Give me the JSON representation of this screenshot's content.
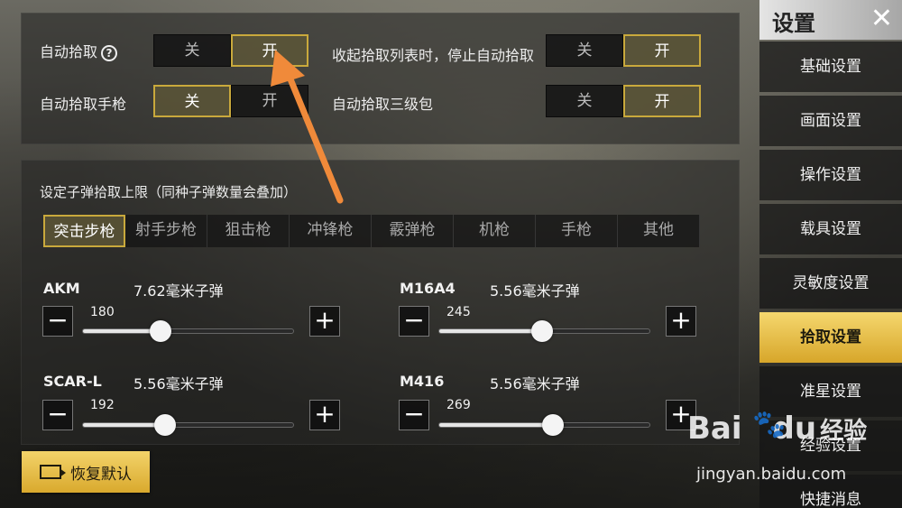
{
  "pickup": {
    "auto_pickup_label": "自动拾取",
    "help_icon": "?",
    "auto_pickup_off": "关",
    "auto_pickup_on": "开",
    "auto_pickup_state": "on",
    "pistol_label": "自动拾取手枪",
    "pistol_off": "关",
    "pistol_on": "开",
    "pistol_state": "off",
    "collapse_label": "收起拾取列表时，停止自动拾取",
    "collapse_off": "关",
    "collapse_on": "开",
    "collapse_state": "on",
    "backpack_label": "自动拾取三级包",
    "backpack_off": "关",
    "backpack_on": "开",
    "backpack_state": "on"
  },
  "ammo": {
    "section_title": "设定子弹拾取上限（同种子弹数量会叠加）",
    "tabs": [
      "突击步枪",
      "射手步枪",
      "狙击枪",
      "冲锋枪",
      "霰弹枪",
      "机枪",
      "手枪",
      "其他"
    ],
    "active_tab": 0,
    "guns": [
      {
        "name": "AKM",
        "ammo": "7.62毫米子弹",
        "value": "180",
        "fraction": 0.37
      },
      {
        "name": "M16A4",
        "ammo": "5.56毫米子弹",
        "value": "245",
        "fraction": 0.49
      },
      {
        "name": "SCAR-L",
        "ammo": "5.56毫米子弹",
        "value": "192",
        "fraction": 0.39
      },
      {
        "name": "M416",
        "ammo": "5.56毫米子弹",
        "value": "269",
        "fraction": 0.54
      }
    ],
    "minus": "−",
    "plus": "+"
  },
  "reset_label": "恢复默认",
  "sidebar": {
    "title": "设置",
    "close": "✕",
    "items": [
      "基础设置",
      "画面设置",
      "操作设置",
      "载具设置",
      "灵敏度设置",
      "拾取设置",
      "准星设置",
      "经验设置",
      "快捷消息"
    ],
    "active_index": 5
  },
  "watermark": {
    "logo": "Bai",
    "logo2": "经验",
    "url": "jingyan.baidu.com"
  },
  "colors": {
    "accent": "#c9a93c",
    "arrow": "#f08a3a"
  }
}
